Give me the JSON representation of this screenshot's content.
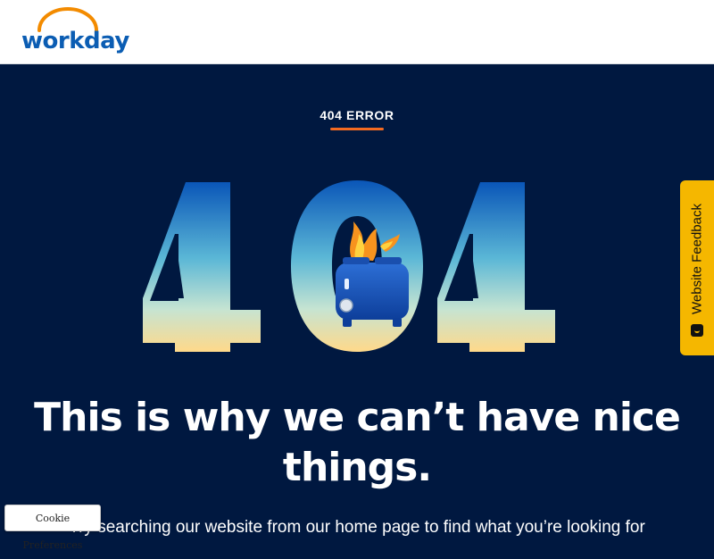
{
  "header": {
    "logo_text": "workday",
    "logo_arc_color": "#f38b00",
    "logo_text_color": "#0b5db3"
  },
  "main": {
    "eyebrow": "404 ERROR",
    "big_number": "404",
    "headline_line1": "This is why we can’t have nice",
    "headline_line2": "things.",
    "subtext": "Try searching our website from our home page to find what you’re looking for",
    "illustration": "toaster-on-fire-icon",
    "accent_color": "#f36a21",
    "background_color": "#001840"
  },
  "feedback": {
    "label": "Website Feedback",
    "icon": "feedback-icon",
    "color": "#f5b700"
  },
  "cookie": {
    "label": "Cookie Preferences"
  }
}
